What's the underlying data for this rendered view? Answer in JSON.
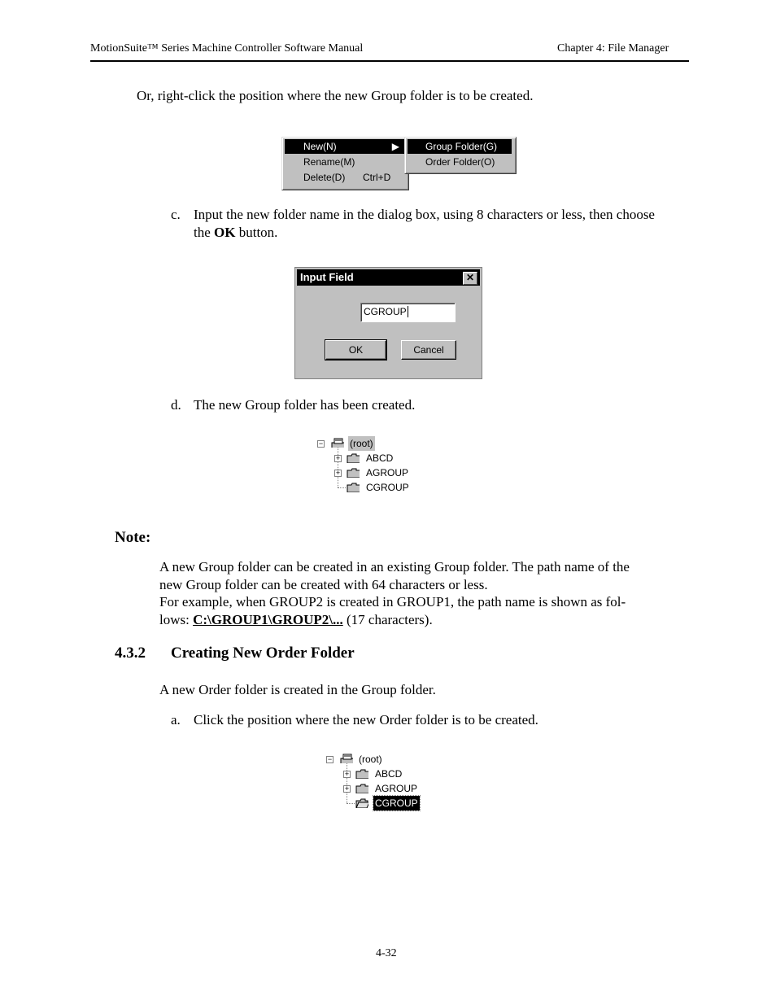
{
  "header": {
    "left": "MotionSuite™ Series Machine Controller Software Manual",
    "right": "Chapter 4:  File Manager"
  },
  "intro_text": "Or, right-click the position where the new Group folder is to be created.",
  "context_menu": {
    "items": [
      {
        "label": "New(N)",
        "shortcut": ""
      },
      {
        "label": "Rename(M)",
        "shortcut": ""
      },
      {
        "label": "Delete(D)",
        "shortcut": "Ctrl+D"
      }
    ],
    "submenu": [
      {
        "label": "Group Folder(G)"
      },
      {
        "label": "Order Folder(O)"
      }
    ]
  },
  "step_c": {
    "marker": "c.",
    "text_before": "Input the new folder name in the dialog box, using 8 characters or less, then choose the ",
    "bold": "OK",
    "text_after": " button."
  },
  "dialog": {
    "title": "Input Field",
    "close": "✕",
    "value": "CGROUP",
    "ok": "OK",
    "cancel": "Cancel"
  },
  "step_d": {
    "marker": "d.",
    "text": "The new Group folder has been created."
  },
  "tree1": {
    "root": "(root)",
    "items": [
      "ABCD",
      "AGROUP",
      "CGROUP"
    ]
  },
  "note": {
    "heading": "Note:",
    "line1": "A new Group folder can be created in an existing Group folder. The path name of the",
    "line2": "new Group folder can be created with 64 characters or less.",
    "line3": "For example, when GROUP2 is created in GROUP1, the path name is shown as fol-",
    "line4_before": "lows: ",
    "line4_bold": "C:\\GROUP1\\GROUP2\\...",
    "line4_after": " (17 characters)."
  },
  "section": {
    "number": "4.3.2",
    "title": "Creating New Order Folder"
  },
  "section_text": "A new Order folder is created in the Group folder.",
  "step_a": {
    "marker": "a.",
    "text": "Click the position where the new Order folder is to be created."
  },
  "tree2": {
    "root": "(root)",
    "items": [
      "ABCD",
      "AGROUP",
      "CGROUP"
    ]
  },
  "footer": {
    "page": "4-32"
  }
}
